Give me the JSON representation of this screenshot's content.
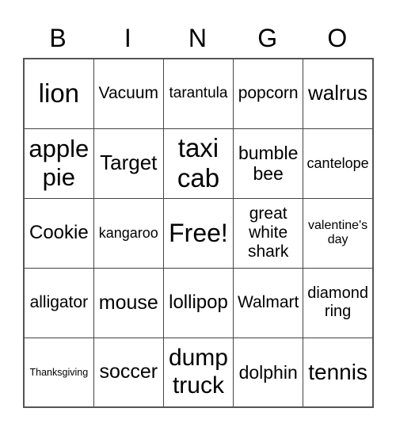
{
  "header": {
    "letters": [
      "B",
      "I",
      "N",
      "G",
      "O"
    ]
  },
  "board": {
    "rows": [
      [
        {
          "text": "lion",
          "size": 33
        },
        {
          "text": "Vacuum",
          "size": 21
        },
        {
          "text": "tarantula",
          "size": 19
        },
        {
          "text": "popcorn",
          "size": 21
        },
        {
          "text": "walrus",
          "size": 26
        }
      ],
      [
        {
          "text": "apple pie",
          "size": 31
        },
        {
          "text": "Target",
          "size": 26
        },
        {
          "text": "taxi cab",
          "size": 33
        },
        {
          "text": "bumble bee",
          "size": 23
        },
        {
          "text": "cantelope",
          "size": 18
        }
      ],
      [
        {
          "text": "Cookie",
          "size": 24
        },
        {
          "text": "kangaroo",
          "size": 18
        },
        {
          "text": "Free!",
          "size": 32
        },
        {
          "text": "great white shark",
          "size": 21
        },
        {
          "text": "valentine's day",
          "size": 16
        }
      ],
      [
        {
          "text": "alligator",
          "size": 21
        },
        {
          "text": "mouse",
          "size": 25
        },
        {
          "text": "lollipop",
          "size": 24
        },
        {
          "text": "Walmart",
          "size": 21
        },
        {
          "text": "diamond ring",
          "size": 20
        }
      ],
      [
        {
          "text": "Thanksgiving",
          "size": 12.5
        },
        {
          "text": "soccer",
          "size": 25
        },
        {
          "text": "dump truck",
          "size": 30
        },
        {
          "text": "dolphin",
          "size": 23
        },
        {
          "text": "tennis",
          "size": 28
        }
      ]
    ]
  }
}
